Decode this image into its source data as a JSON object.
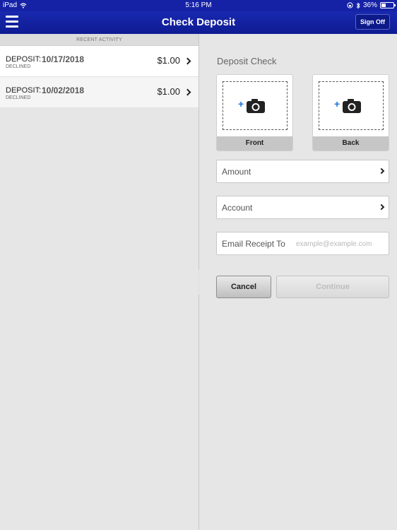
{
  "status_bar": {
    "device": "iPad",
    "time": "5:16 PM",
    "battery": "36%",
    "battery_level": 0.36
  },
  "header": {
    "title": "Check Deposit",
    "sign_off_label": "Sign Off",
    "menu_icon": "hamburger-icon"
  },
  "recent_activity": {
    "header": "RECENT ACTIVITY",
    "items": [
      {
        "type": "DEPOSIT:",
        "date": "10/17/2018",
        "status": "DECLINED",
        "amount": "$1.00"
      },
      {
        "type": "DEPOSIT:",
        "date": "10/02/2018",
        "status": "DECLINED",
        "amount": "$1.00"
      }
    ]
  },
  "deposit": {
    "title": "Deposit Check",
    "front_label": "Front",
    "back_label": "Back",
    "amount_label": "Amount",
    "account_label": "Account",
    "email_label": "Email Receipt To",
    "email_placeholder": "example@example.com",
    "cancel_label": "Cancel",
    "continue_label": "Continue"
  },
  "colors": {
    "nav_bar": "#1522a6",
    "plus_accent": "#1a73d9"
  }
}
